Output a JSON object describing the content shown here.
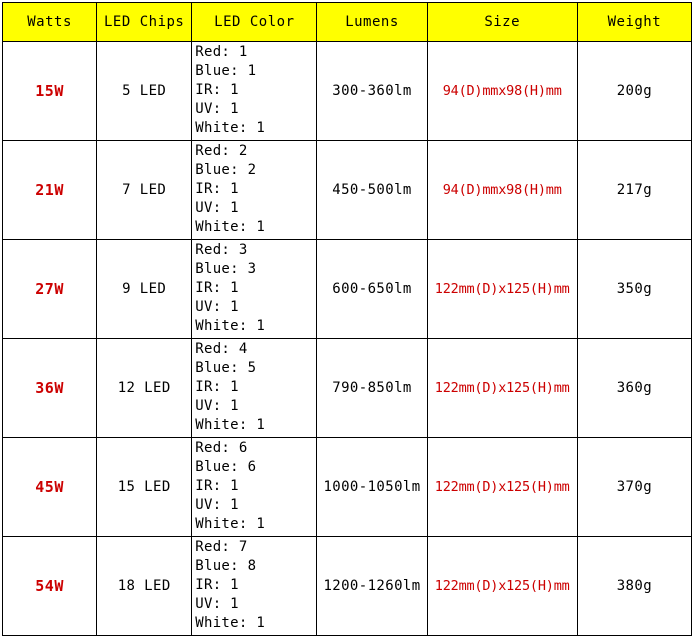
{
  "table": {
    "headers": [
      {
        "key": "watts",
        "label": "Watts"
      },
      {
        "key": "chips",
        "label": "LED Chips"
      },
      {
        "key": "color",
        "label": "LED Color"
      },
      {
        "key": "lumens",
        "label": "Lumens"
      },
      {
        "key": "size",
        "label": "Size"
      },
      {
        "key": "weight",
        "label": "Weight"
      }
    ],
    "colors": {
      "header_background": "#ffff00",
      "header_text": "#000000",
      "accent_text": "#cc0000",
      "body_text": "#000000",
      "border": "#000000",
      "cell_background": "#ffffff"
    },
    "rows": [
      {
        "watts": "15W",
        "chips": "5 LED",
        "color": [
          "Red: 1",
          "Blue: 1",
          "IR: 1",
          "UV: 1",
          "White: 1"
        ],
        "lumens": "300-360lm",
        "size": "94(D)mmx98(H)mm",
        "weight": "200g"
      },
      {
        "watts": "21W",
        "chips": "7 LED",
        "color": [
          "Red: 2",
          "Blue: 2",
          "IR: 1",
          "UV: 1",
          "White: 1"
        ],
        "lumens": "450-500lm",
        "size": "94(D)mmx98(H)mm",
        "weight": "217g"
      },
      {
        "watts": "27W",
        "chips": "9 LED",
        "color": [
          "Red: 3",
          "Blue: 3",
          "IR: 1",
          "UV: 1",
          "White: 1"
        ],
        "lumens": "600-650lm",
        "size": "122mm(D)x125(H)mm",
        "weight": "350g"
      },
      {
        "watts": "36W",
        "chips": "12 LED",
        "color": [
          "Red: 4",
          "Blue: 5",
          "IR: 1",
          "UV: 1",
          "White: 1"
        ],
        "lumens": "790-850lm",
        "size": "122mm(D)x125(H)mm",
        "weight": "360g"
      },
      {
        "watts": "45W",
        "chips": "15 LED",
        "color": [
          "Red: 6",
          "Blue: 6",
          "IR: 1",
          "UV: 1",
          "White: 1"
        ],
        "lumens": "1000-1050lm",
        "size": "122mm(D)x125(H)mm",
        "weight": "370g"
      },
      {
        "watts": "54W",
        "chips": "18 LED",
        "color": [
          "Red: 7",
          "Blue: 8",
          "IR: 1",
          "UV: 1",
          "White: 1"
        ],
        "lumens": "1200-1260lm",
        "size": "122mm(D)x125(H)mm",
        "weight": "380g"
      }
    ]
  }
}
